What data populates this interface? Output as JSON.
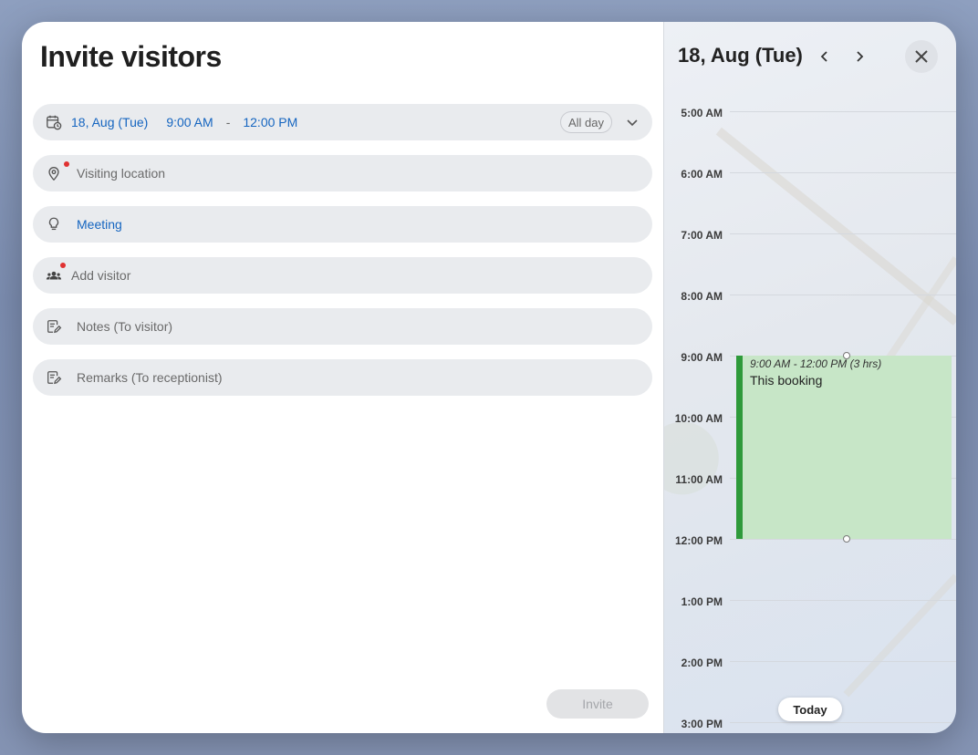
{
  "modal": {
    "title": "Invite visitors",
    "invite_label": "Invite"
  },
  "date_field": {
    "date": "18, Aug (Tue)",
    "start": "9:00 AM",
    "separator": "-",
    "end": "12:00 PM",
    "all_day_label": "All day",
    "icon": "calendar-clock-icon"
  },
  "location_field": {
    "placeholder": "Visiting location",
    "icon": "map-pin-icon",
    "required": true
  },
  "purpose_field": {
    "value": "Meeting",
    "icon": "lightbulb-icon"
  },
  "visitor_field": {
    "placeholder": "Add visitor",
    "icon": "people-icon",
    "required": true
  },
  "notes_field": {
    "placeholder": "Notes (To visitor)",
    "icon": "note-edit-icon"
  },
  "remarks_field": {
    "placeholder": "Remarks (To receptionist)",
    "icon": "note-edit-icon"
  },
  "calendar": {
    "date_label": "18, Aug (Tue)",
    "hours": [
      "5:00 AM",
      "6:00 AM",
      "7:00 AM",
      "8:00 AM",
      "9:00 AM",
      "10:00 AM",
      "11:00 AM",
      "12:00 PM",
      "1:00 PM",
      "2:00 PM",
      "3:00 PM"
    ],
    "booking": {
      "time_range": "9:00 AM - 12:00 PM (3 hrs)",
      "name": "This booking",
      "start_hour_index": 4,
      "duration_hours": 3
    },
    "today_label": "Today"
  },
  "colors": {
    "accent_blue": "#1565c0",
    "booking_fill": "#c7e6c7",
    "booking_bar": "#2e9a3a",
    "required_dot": "#e03131"
  }
}
